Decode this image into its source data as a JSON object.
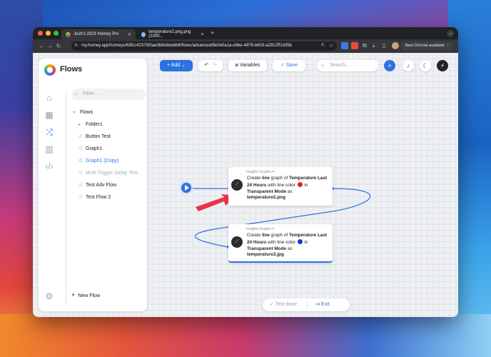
{
  "browser": {
    "tabs": [
      {
        "title": "Josh's 2023 Homey Pro",
        "active": true
      },
      {
        "title": "temperature2.png.png (1000...",
        "active": false
      }
    ],
    "url": "my.homey.app/homeys/63fcc4237fd0ae0b8e9eebb6/flows/advanced/8e0e0a1a-e9be-4976-b603-a2912ff1d35b",
    "update_label": "New Chrome available"
  },
  "app": {
    "title": "Flows",
    "filter_placeholder": "Filter...",
    "tree": [
      {
        "label": "Flows",
        "type": "root"
      },
      {
        "label": "Folder1",
        "type": "folder"
      },
      {
        "label": "Button Test",
        "type": "flow"
      },
      {
        "label": "Graph1",
        "type": "flow"
      },
      {
        "label": "Graph1 (Copy)",
        "type": "flow",
        "selected": true
      },
      {
        "label": "Multi Trigger Delay Test",
        "type": "flow",
        "disabled": true
      },
      {
        "label": "Test Adv Flow",
        "type": "flow"
      },
      {
        "label": "Test Flow 2",
        "type": "flow"
      }
    ],
    "new_flow_label": "New Flow"
  },
  "toolbar": {
    "add_label": "Add",
    "variables_label": "Variables",
    "save_label": "Save",
    "search_placeholder": "Search..."
  },
  "cards": [
    {
      "header": "Insights Graphs",
      "segments": [
        "Create ",
        "line",
        " graph of ",
        "Temperature Last 24 Hours",
        " with line color ",
        " in ",
        "Transparent Mode",
        " as ",
        "temperature2.png"
      ],
      "dot_color": "#e81c1c"
    },
    {
      "header": "Insights Graphs",
      "segments": [
        "Create ",
        "line",
        " graph of ",
        "Temperature Last 24 Hours",
        " with line color ",
        " in ",
        "Transparent Mode",
        " as ",
        "temperature3.jpg"
      ],
      "dot_color": "#1a32d6"
    }
  ],
  "bottom": {
    "test_label": "Test done",
    "exit_label": "Exit"
  },
  "colors": {
    "accent": "#2d72e0",
    "arrow": "#e8334a"
  }
}
